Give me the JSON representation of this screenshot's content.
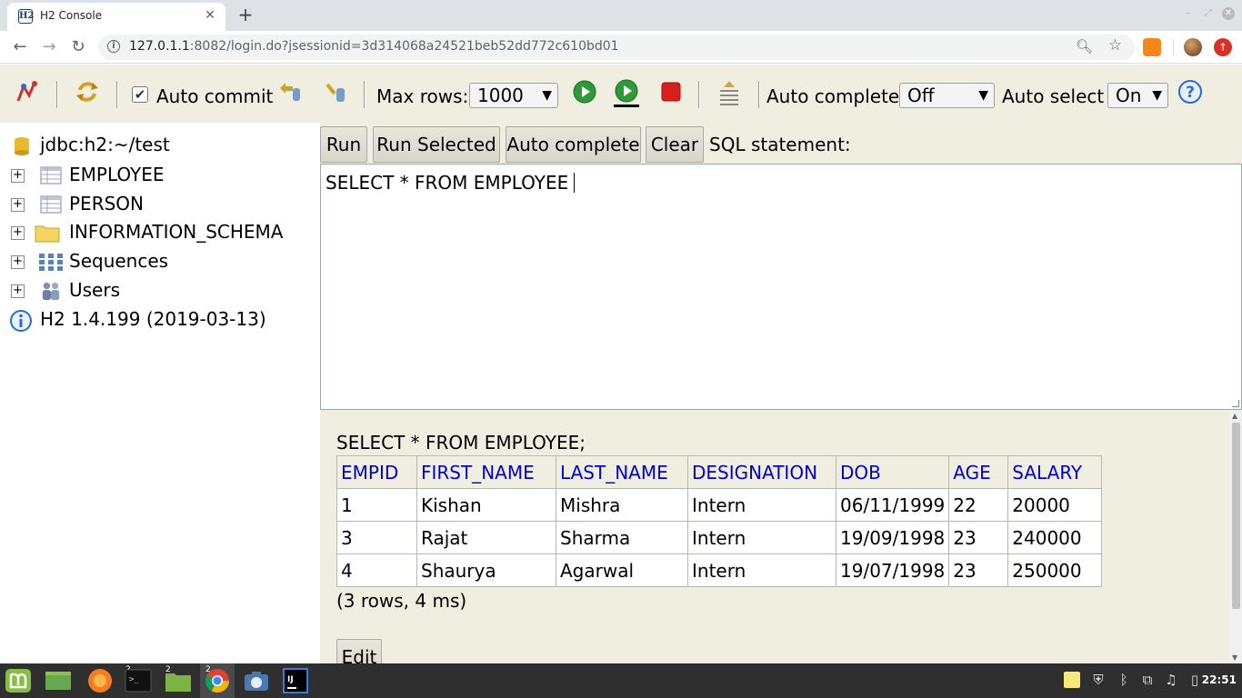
{
  "browser": {
    "tab_title": "H2 Console",
    "tab_favicon": "H2",
    "close_glyph": "✕",
    "newtab_glyph": "+",
    "url_host": "127.0.1.1",
    "url_path": ":8082/login.do?jsessionid=3d314068a24521beb52dd772c610bd01"
  },
  "h2_toolbar": {
    "auto_commit_label": "Auto commit",
    "max_rows_label": "Max rows:",
    "max_rows_value": "1000",
    "auto_complete_label": "Auto complete",
    "auto_complete_value": "Off",
    "auto_select_label": "Auto select",
    "auto_select_value": "On",
    "dropdown_arrow": "▼",
    "check_mark": "✔"
  },
  "tree": {
    "connection": "jdbc:h2:~/test",
    "items": [
      {
        "label": "EMPLOYEE",
        "icon": "table-icon"
      },
      {
        "label": "PERSON",
        "icon": "table-icon"
      },
      {
        "label": "INFORMATION_SCHEMA",
        "icon": "folder-icon"
      },
      {
        "label": "Sequences",
        "icon": "sequences-icon"
      },
      {
        "label": "Users",
        "icon": "users-icon"
      }
    ],
    "expand_glyph": "+",
    "version": "H2 1.4.199 (2019-03-13)"
  },
  "query": {
    "run_label": "Run",
    "run_selected_label": "Run Selected",
    "auto_complete_label": "Auto complete",
    "clear_label": "Clear",
    "sql_statement_label": "SQL statement:",
    "sql_text": "SELECT * FROM EMPLOYEE"
  },
  "results": {
    "query_echo": "SELECT * FROM EMPLOYEE;",
    "columns": [
      "EMPID",
      "FIRST_NAME",
      "LAST_NAME",
      "DESIGNATION",
      "DOB",
      "AGE",
      "SALARY"
    ],
    "rows": [
      [
        "1",
        "Kishan",
        "Mishra",
        "Intern",
        "06/11/1999",
        "22",
        "20000"
      ],
      [
        "3",
        "Rajat",
        "Sharma",
        "Intern",
        "19/09/1998",
        "23",
        "240000"
      ],
      [
        "4",
        "Shaurya",
        "Agarwal",
        "Intern",
        "19/07/1998",
        "23",
        "250000"
      ]
    ],
    "row_count": "(3 rows, 4 ms)",
    "edit_label": "Edit"
  },
  "taskbar": {
    "badges": [
      "2",
      "2",
      "2"
    ],
    "clock": "22:51"
  },
  "colors": {
    "h2_background": "#f0eee0",
    "column_header_link": "#0000cc",
    "taskbar": "#2f2f2f"
  }
}
